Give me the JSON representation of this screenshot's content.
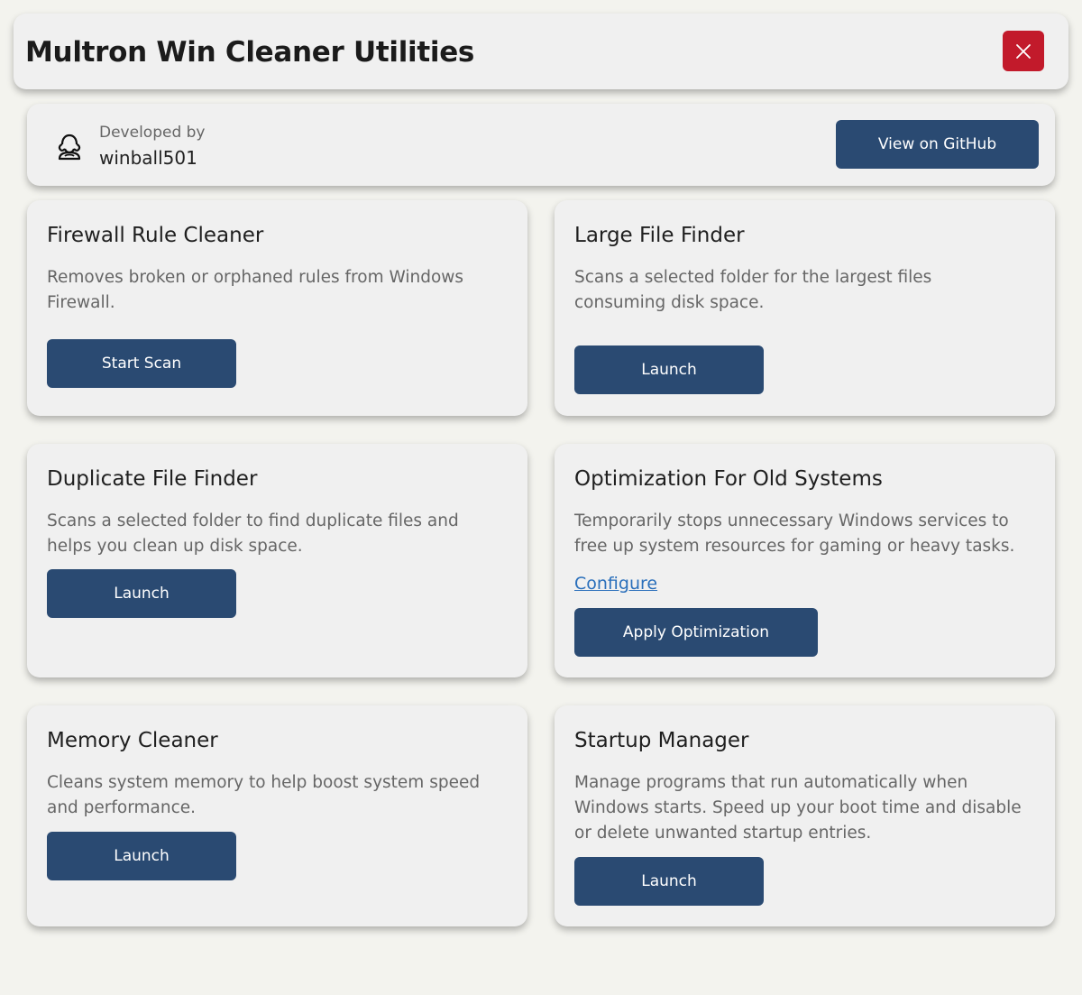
{
  "header": {
    "title": "Multron Win Cleaner Utilities",
    "close_icon": "close-icon"
  },
  "developer": {
    "caption": "Developed by",
    "name": "winball501",
    "icon": "user-avatar-icon",
    "github_label": "View on GitHub"
  },
  "cards": [
    {
      "title": "Firewall Rule Cleaner",
      "description": "Removes broken or orphaned rules from Windows Firewall.",
      "button": "Start Scan"
    },
    {
      "title": "Large File Finder",
      "description": "Scans a selected folder for the largest files consuming disk space.",
      "button": "Launch"
    },
    {
      "title": "Duplicate File Finder",
      "description": "Scans a selected folder to find duplicate files and helps you clean up disk space.",
      "button": "Launch"
    },
    {
      "title": "Optimization For Old Systems",
      "description": "Temporarily stops unnecessary Windows services to free up system resources for gaming or heavy tasks.",
      "link": "Configure",
      "button": "Apply Optimization"
    },
    {
      "title": "Memory Cleaner",
      "description": "Cleans system memory to help boost system speed and performance.",
      "button": "Launch"
    },
    {
      "title": "Startup Manager",
      "description": "Manage programs that run automatically when Windows starts. Speed up your boot time and disable or delete unwanted startup entries.",
      "button": "Launch"
    }
  ],
  "colors": {
    "background": "#f3f3ee",
    "card": "#f0f0f0",
    "button": "#2a4a72",
    "close": "#c21a2b",
    "link": "#2a6fbb"
  }
}
